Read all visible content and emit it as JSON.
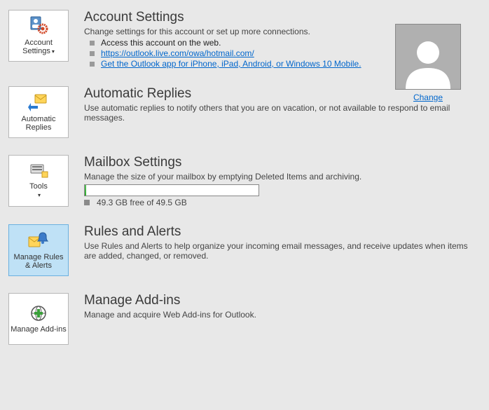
{
  "accountSettings": {
    "heading": "Account Settings",
    "desc": "Change settings for this account or set up more connections.",
    "li1": "Access this account on the web.",
    "li2": "https://outlook.live.com/owa/hotmail.com/",
    "li3": "Get the Outlook app for iPhone, iPad, Android, or Windows 10 Mobile.",
    "tileLabel": "Account Settings",
    "changeLabel": "Change"
  },
  "autoReplies": {
    "heading": "Automatic Replies",
    "desc": "Use automatic replies to notify others that you are on vacation, or not available to respond to email messages.",
    "tileLabel": "Automatic Replies"
  },
  "mailbox": {
    "heading": "Mailbox Settings",
    "desc": "Manage the size of your mailbox by emptying Deleted Items and archiving.",
    "tileLabel": "Tools",
    "storage": "49.3 GB free of 49.5 GB"
  },
  "rules": {
    "heading": "Rules and Alerts",
    "desc": "Use Rules and Alerts to help organize your incoming email messages, and receive updates when items are added, changed, or removed.",
    "tileLabel": "Manage Rules & Alerts"
  },
  "addins": {
    "heading": "Manage Add-ins",
    "desc": "Manage and acquire Web Add-ins for Outlook.",
    "tileLabel": "Manage Add-ins"
  }
}
